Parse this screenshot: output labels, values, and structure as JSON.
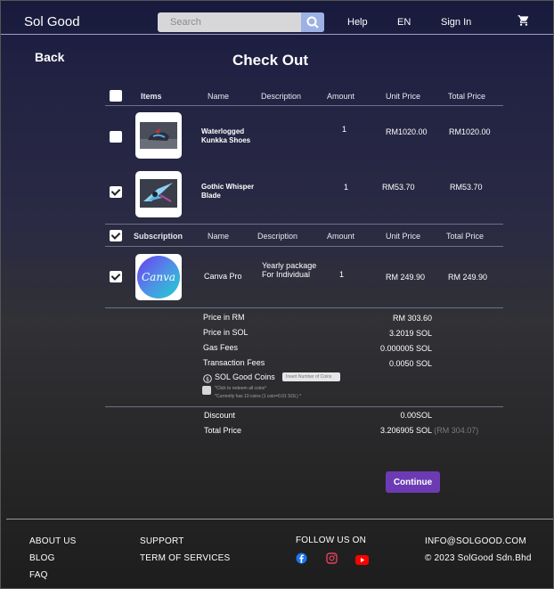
{
  "header": {
    "brand": "Sol Good",
    "search_placeholder": "Search",
    "nav": {
      "help": "Help",
      "language": "EN",
      "sign_in": "Sign In"
    },
    "icons": {
      "search": "search-icon",
      "cart": "cart-icon"
    }
  },
  "page": {
    "back": "Back",
    "title": "Check Out"
  },
  "items_table": {
    "headers": {
      "items": "Items",
      "name": "Name",
      "description": "Description",
      "amount": "Amount",
      "unit_price": "Unit Price",
      "total_price": "Total Price"
    },
    "rows": [
      {
        "checked": false,
        "name": "Waterlogged Kunkka Shoes",
        "description": "",
        "amount": "1",
        "unit_price": "RM1020.00",
        "total_price": "RM1020.00"
      },
      {
        "checked": true,
        "name": "Gothic Whisper Blade",
        "description": "",
        "amount": "1",
        "unit_price": "RM53.70",
        "total_price": "RM53.70"
      }
    ]
  },
  "subscription_table": {
    "headers": {
      "subscription": "Subscription",
      "name": "Name",
      "description": "Description",
      "amount": "Amount",
      "unit_price": "Unit Price",
      "total_price": "Total Price"
    },
    "rows": [
      {
        "checked": true,
        "logo": "Canva",
        "name": "Canva Pro",
        "description": "Yearly package For Individual",
        "amount": "1",
        "unit_price": "RM 249.90",
        "total_price": "RM 249.90"
      }
    ]
  },
  "summary": {
    "price_rm_label": "Price in RM",
    "price_rm": "RM 303.60",
    "price_sol_label": "Price in SOL",
    "price_sol": "3.2019 SOL",
    "gas_label": "Gas Fees",
    "gas": "0.000005 SOL",
    "tx_label": "Transaction Fees",
    "tx": "0.0050 SOL",
    "coins_label": "SOL Good Coins",
    "coins_placeholder": "Insert Number of Coins",
    "coins_note_1": "*Click to redeem all coins*",
    "coins_note_2": "*Currently has 10 coins (1 coin=0.01 SOL) *",
    "discount_label": "Discount",
    "discount": "0.00SOL",
    "total_label": "Total Price",
    "total_sol": "3.206905 SOL",
    "total_rm": "(RM 304.07)"
  },
  "actions": {
    "continue": "Continue"
  },
  "footer": {
    "about": "ABOUT US",
    "blog": "BLOG",
    "faq": "FAQ",
    "support": "SUPPORT",
    "terms": "TERM OF SERVICES",
    "follow": "FOLLOW US ON",
    "email": "INFO@SOLGOOD.COM",
    "copyright": "© 2023 SolGood Sdn.Bhd",
    "social_colors": {
      "facebook": "#1877f2",
      "instagram": "#e4405f",
      "youtube": "#ff0000"
    }
  }
}
